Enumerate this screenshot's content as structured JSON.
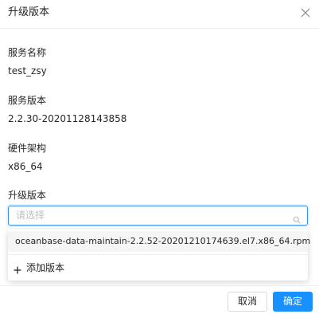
{
  "modal": {
    "title": "升级版本",
    "close_icon": "close-icon"
  },
  "fields": {
    "service_name_label": "服务名称",
    "service_name_value": "test_zsy",
    "service_version_label": "服务版本",
    "service_version_value": "2.2.30-20201128143858",
    "hardware_arch_label": "硬件架构",
    "hardware_arch_value": "x86_64",
    "upgrade_version_label": "升级版本"
  },
  "select": {
    "placeholder": "请选择",
    "search_icon": "search-icon"
  },
  "dropdown": {
    "options": [
      "oceanbase-data-maintain-2.2.52-20201210174639.el7.x86_64.rpm"
    ],
    "add_label": "添加版本",
    "add_icon": "plus-icon"
  },
  "footer": {
    "cancel_label": "取消",
    "ok_label": "确定"
  },
  "colors": {
    "primary": "#1890ff",
    "focus_border": "#3b8ff0",
    "placeholder": "#bfbfbf",
    "text": "#262626"
  }
}
